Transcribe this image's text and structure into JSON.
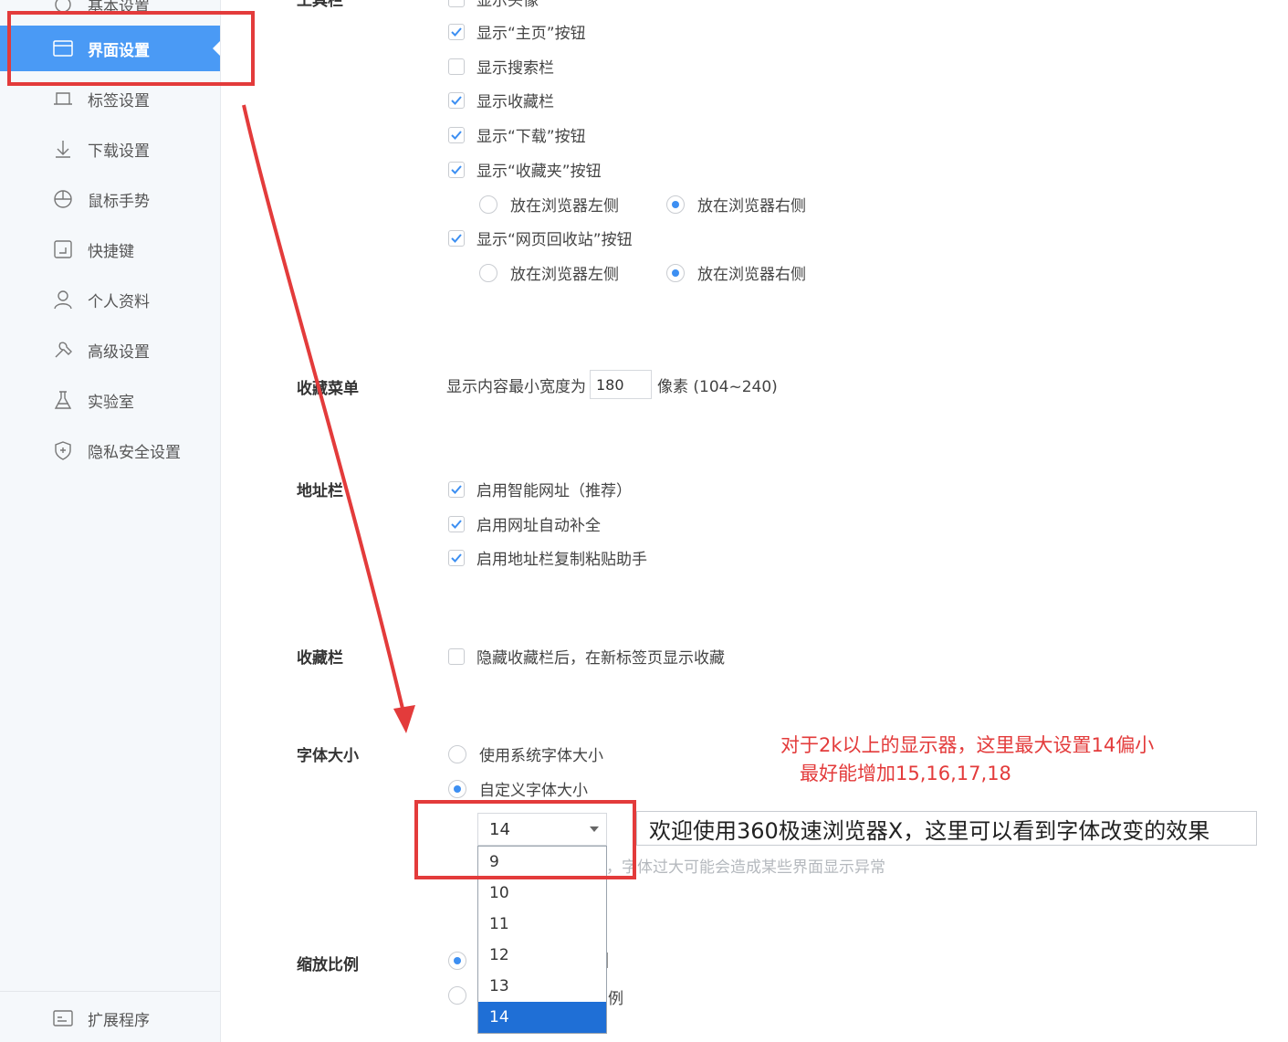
{
  "sidebar": {
    "items": [
      {
        "label": "基本设置",
        "icon": "palette-icon"
      },
      {
        "label": "界面设置",
        "icon": "window-icon",
        "active": true
      },
      {
        "label": "标签设置",
        "icon": "tab-icon"
      },
      {
        "label": "下载设置",
        "icon": "download-icon"
      },
      {
        "label": "鼠标手势",
        "icon": "mouse-icon"
      },
      {
        "label": "快捷键",
        "icon": "shortcut-icon"
      },
      {
        "label": "个人资料",
        "icon": "user-icon"
      },
      {
        "label": "高级设置",
        "icon": "tools-icon"
      },
      {
        "label": "实验室",
        "icon": "flask-icon"
      },
      {
        "label": "隐私安全设置",
        "icon": "shield-icon"
      }
    ],
    "extensions": {
      "label": "扩展程序",
      "icon": "extension-icon"
    }
  },
  "toolbar_section": {
    "title": "工具栏",
    "items": [
      {
        "label": "显示头像",
        "checked": false
      },
      {
        "label": "显示“主页”按钮",
        "checked": true
      },
      {
        "label": "显示搜索栏",
        "checked": false
      },
      {
        "label": "显示收藏栏",
        "checked": true
      },
      {
        "label": "显示“下载”按钮",
        "checked": true
      },
      {
        "label": "显示“收藏夹”按钮",
        "checked": true
      },
      {
        "label": "显示“网页回收站”按钮",
        "checked": true
      }
    ],
    "fav_position": {
      "left": "放在浏览器左侧",
      "right": "放在浏览器右侧",
      "selected": "right"
    },
    "recycle_position": {
      "left": "放在浏览器左侧",
      "right": "放在浏览器右侧",
      "selected": "right"
    }
  },
  "fav_menu": {
    "title": "收藏菜单",
    "prefix": "显示内容最小宽度为",
    "value": "180",
    "suffix": "像素 (104~240)"
  },
  "address_bar": {
    "title": "地址栏",
    "items": [
      {
        "label": "启用智能网址（推荐）",
        "checked": true
      },
      {
        "label": "启用网址自动补全",
        "checked": true
      },
      {
        "label": "启用地址栏复制粘贴助手",
        "checked": true
      }
    ]
  },
  "fav_bar": {
    "title": "收藏栏",
    "items": [
      {
        "label": "隐藏收藏栏后，在新标签页显示收藏",
        "checked": false
      }
    ]
  },
  "font_size": {
    "title": "字体大小",
    "system_label": "使用系统字体大小",
    "custom_label": "自定义字体大小",
    "selected": "custom",
    "current_value": "14",
    "preview_text": "欢迎使用360极速浏览器X，这里可以看到字体改变的效果",
    "warning_text": "，字体过大可能会造成某些界面显示异常",
    "options": [
      "9",
      "10",
      "11",
      "12",
      "13",
      "14"
    ],
    "selected_option": "14"
  },
  "zoom": {
    "title": "缩放比例",
    "partial_labels": [
      "|",
      "例"
    ]
  },
  "annotation": {
    "line1": "对于2k以上的显示器，这里最大设置14偏小",
    "line2": "最好能增加15,16,17,18",
    "color": "#e33b3b"
  }
}
